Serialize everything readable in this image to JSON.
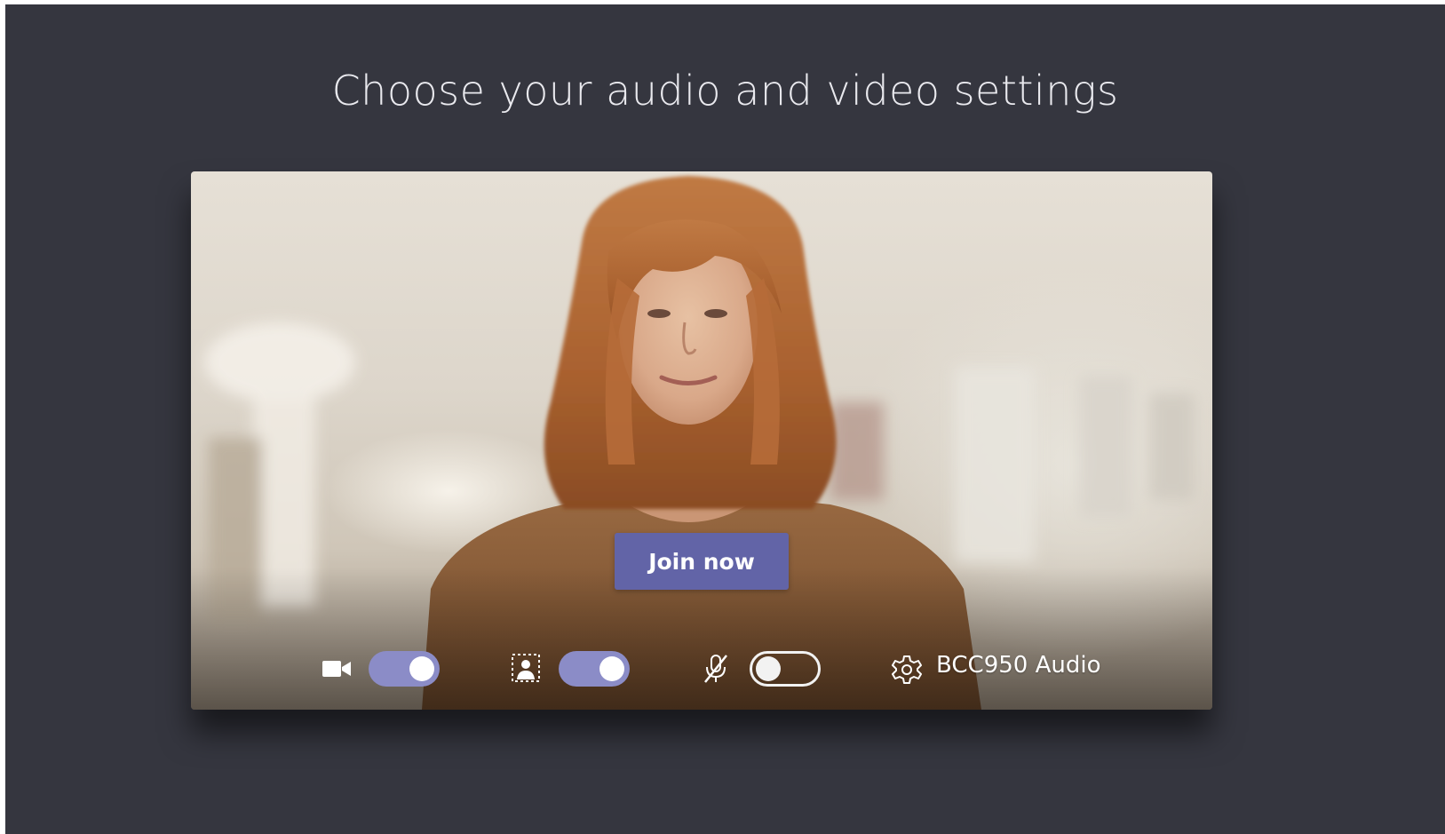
{
  "title": "Choose your audio and video settings",
  "preview": {
    "subject": "camera preview of participant",
    "join_label": "Join now"
  },
  "controls": {
    "camera": {
      "icon": "video-camera-icon",
      "state": "on"
    },
    "background_effects": {
      "icon": "background-blur-icon",
      "state": "on"
    },
    "microphone": {
      "icon": "microphone-muted-icon",
      "state": "off"
    },
    "audio_device": {
      "icon": "gear-icon",
      "label": "BCC950 Audio"
    }
  },
  "colors": {
    "background": "#35363f",
    "accent": "#6264a7",
    "toggle_on": "#8b8cc7"
  }
}
